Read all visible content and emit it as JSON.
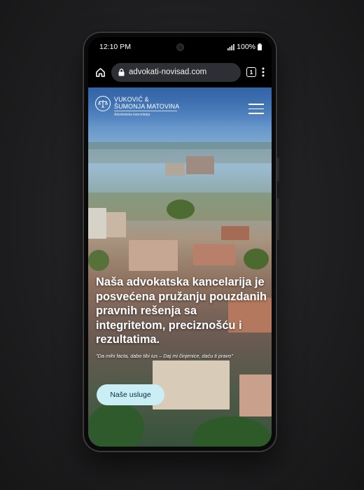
{
  "status_bar": {
    "time": "12:10 PM",
    "battery": "100%"
  },
  "browser": {
    "url": "advokati-novisad.com",
    "tab_count": "1"
  },
  "site": {
    "logo_line1": "VUKOVIĆ &",
    "logo_line2": "ŠUMONJA MATOVINA",
    "logo_sub": "Advokatska kancelarija",
    "hero_title": "Naša advokatska kancelarija je posvećena pružanju pouzdanih pravnih rešenja sa integritetom, preciznošću i rezultatima.",
    "hero_quote": "\"Da mihi facta, dabo tibi ius – Daj mi činjenice, daću ti pravo\"",
    "cta_label": "Naše usluge"
  },
  "colors": {
    "cta_background": "#c9eef5",
    "page_background": "#1f1f21"
  },
  "icons": [
    "home-icon",
    "lock-icon",
    "tabs-icon",
    "more-vert-icon",
    "hamburger-menu-icon",
    "scales-of-justice-icon",
    "signal-icon",
    "battery-icon"
  ]
}
